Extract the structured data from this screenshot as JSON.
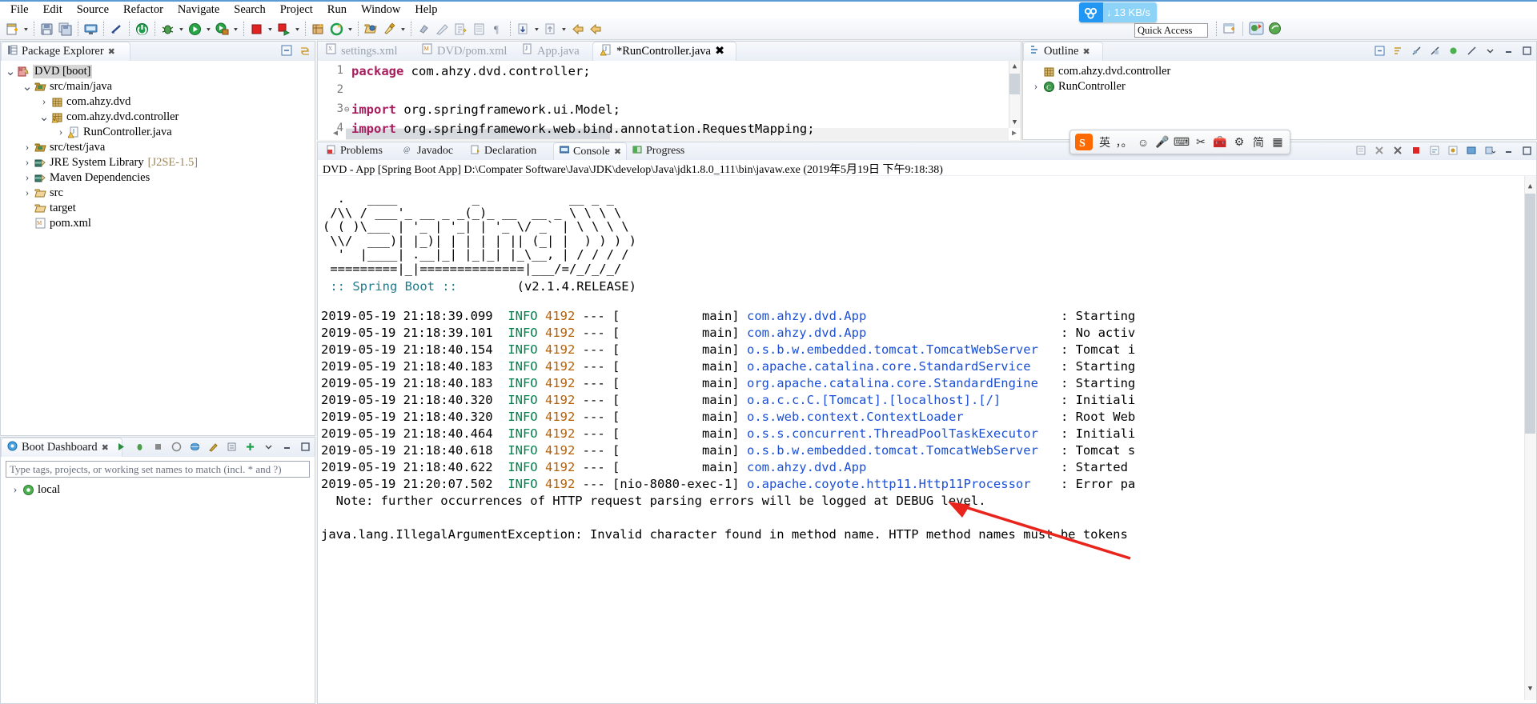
{
  "menubar": {
    "items": [
      {
        "label": "File",
        "mnemonic": "F"
      },
      {
        "label": "Edit",
        "mnemonic": "E"
      },
      {
        "label": "Source",
        "mnemonic": "S"
      },
      {
        "label": "Refactor",
        "mnemonic": "t"
      },
      {
        "label": "Navigate",
        "mnemonic": "N"
      },
      {
        "label": "Search",
        "mnemonic": "a"
      },
      {
        "label": "Project",
        "mnemonic": "P"
      },
      {
        "label": "Run",
        "mnemonic": "R"
      },
      {
        "label": "Window",
        "mnemonic": "W"
      },
      {
        "label": "Help",
        "mnemonic": "H"
      }
    ]
  },
  "toolbar": {
    "icons": [
      "new-wizard-icon",
      "save-icon",
      "save-all-icon",
      "print-screen-icon",
      "toggle-breakpoint-icon",
      "terminate-icon",
      "debug-icon",
      "run-icon",
      "run-external-tools-icon",
      "stop-icon",
      "coverage-icon",
      "new-package-icon",
      "refresh-icon",
      "open-type-icon",
      "search-icon",
      "pin-icon",
      "annotation-icon",
      "next-edit-icon",
      "previous-edit-icon",
      "paragraph-icon",
      "next-annotation-icon",
      "previous-annotation-icon",
      "back-icon",
      "forward-icon"
    ]
  },
  "download_widget": {
    "name": "download-speed-indicator",
    "speed": "13 KB/s",
    "arrow": "↓",
    "bg_color": "#2196f3",
    "value_bg": "#8dd3f7"
  },
  "quick_access": {
    "label": "Quick Access",
    "placeholder": "Quick Access"
  },
  "package_explorer": {
    "title": "Package Explorer",
    "tree": [
      {
        "label": "DVD [boot]",
        "indent": 0,
        "twist": "v",
        "icon": "maven-project-icon",
        "selected": true
      },
      {
        "label": "src/main/java",
        "indent": 1,
        "twist": "v",
        "icon": "source-folder-icon"
      },
      {
        "label": "com.ahzy.dvd",
        "indent": 2,
        "twist": ">",
        "icon": "package-icon"
      },
      {
        "label": "com.ahzy.dvd.controller",
        "indent": 2,
        "twist": "v",
        "icon": "package-warning-icon"
      },
      {
        "label": "RunController.java",
        "indent": 3,
        "twist": ">",
        "icon": "java-file-warning-icon"
      },
      {
        "label": "src/test/java",
        "indent": 1,
        "twist": ">",
        "icon": "source-folder-icon"
      },
      {
        "label": "JRE System Library",
        "suffix": "[J2SE-1.5]",
        "indent": 1,
        "twist": ">",
        "icon": "library-icon"
      },
      {
        "label": "Maven Dependencies",
        "indent": 1,
        "twist": ">",
        "icon": "library-icon"
      },
      {
        "label": "src",
        "indent": 1,
        "twist": ">",
        "icon": "folder-icon"
      },
      {
        "label": "target",
        "indent": 1,
        "twist": "",
        "icon": "folder-icon"
      },
      {
        "label": "pom.xml",
        "indent": 1,
        "twist": "",
        "icon": "maven-pom-icon"
      }
    ]
  },
  "boot_dashboard": {
    "title": "Boot Dashboard",
    "filter_placeholder": "Type tags, projects, or working set names to match (incl. * and ?)",
    "items": [
      {
        "label": "local",
        "twist": ">",
        "icon": "boot-local-icon"
      }
    ]
  },
  "editor": {
    "tabs": [
      {
        "label": "settings.xml",
        "icon": "xml-file-icon",
        "active": false
      },
      {
        "label": "DVD/pom.xml",
        "icon": "maven-file-icon",
        "active": false
      },
      {
        "label": "App.java",
        "icon": "java-file-icon",
        "active": false
      },
      {
        "label": "*RunController.java",
        "icon": "java-file-warning-icon",
        "active": true
      }
    ],
    "lines": [
      {
        "num": "1",
        "fold": "",
        "code": "package com.ahzy.dvd.controller;",
        "keyword": "package"
      },
      {
        "num": "2",
        "fold": "",
        "code": "",
        "keyword": ""
      },
      {
        "num": "3",
        "fold": "⊖",
        "code": "import org.springframework.ui.Model;",
        "keyword": "import"
      },
      {
        "num": "4",
        "fold": "",
        "code": "import org.springframework.web.bind.annotation.RequestMapping;",
        "keyword": "import"
      }
    ]
  },
  "outline": {
    "title": "Outline",
    "items": [
      {
        "label": "com.ahzy.dvd.controller",
        "twist": "",
        "icon": "package-icon",
        "indent": 0
      },
      {
        "label": "RunController",
        "twist": ">",
        "icon": "class-icon",
        "indent": 0
      }
    ]
  },
  "bottom_panel": {
    "tabs": [
      {
        "label": "Problems",
        "icon": "problems-icon",
        "active": false
      },
      {
        "label": "Javadoc",
        "icon": "javadoc-icon",
        "active": false
      },
      {
        "label": "Declaration",
        "icon": "declaration-icon",
        "active": false
      },
      {
        "label": "Console",
        "icon": "console-icon",
        "active": true
      },
      {
        "label": "Progress",
        "icon": "progress-icon",
        "active": false
      }
    ],
    "launch_line": "DVD - App [Spring Boot App] D:\\Compater Software\\Java\\JDK\\develop\\Java\\jdk1.8.0_111\\bin\\javaw.exe (2019年5月19日 下午9:18:38)"
  },
  "console": {
    "banner": [
      "  .   ____          _            __ _ _",
      " /\\\\ / ___'_ __ _ _(_)_ __  __ _ \\ \\ \\ \\",
      "( ( )\\___ | '_ | '_| | '_ \\/ _` | \\ \\ \\ \\",
      " \\\\/  ___)| |_)| | | | | || (_| |  ) ) ) )",
      "  '  |____| .__|_| |_|_| |_\\__, | / / / /",
      " =========|_|==============|___/=/_/_/_/"
    ],
    "banner_title": " :: Spring Boot :: ",
    "banner_version": "       (v2.1.4.RELEASE)",
    "log_lines": [
      {
        "time": "2019-05-19 21:18:39.099",
        "level": "INFO",
        "pid": "4192",
        "sep": "--- [",
        "thread": "           main]",
        "cls": "com.ahzy.dvd.App",
        "msg": ": Starting"
      },
      {
        "time": "2019-05-19 21:18:39.101",
        "level": "INFO",
        "pid": "4192",
        "sep": "--- [",
        "thread": "           main]",
        "cls": "com.ahzy.dvd.App",
        "msg": ": No activ"
      },
      {
        "time": "2019-05-19 21:18:40.154",
        "level": "INFO",
        "pid": "4192",
        "sep": "--- [",
        "thread": "           main]",
        "cls": "o.s.b.w.embedded.tomcat.TomcatWebServer",
        "msg": ": Tomcat i"
      },
      {
        "time": "2019-05-19 21:18:40.183",
        "level": "INFO",
        "pid": "4192",
        "sep": "--- [",
        "thread": "           main]",
        "cls": "o.apache.catalina.core.StandardService",
        "msg": ": Starting"
      },
      {
        "time": "2019-05-19 21:18:40.183",
        "level": "INFO",
        "pid": "4192",
        "sep": "--- [",
        "thread": "           main]",
        "cls": "org.apache.catalina.core.StandardEngine",
        "msg": ": Starting"
      },
      {
        "time": "2019-05-19 21:18:40.320",
        "level": "INFO",
        "pid": "4192",
        "sep": "--- [",
        "thread": "           main]",
        "cls": "o.a.c.c.C.[Tomcat].[localhost].[/]",
        "msg": ": Initiali"
      },
      {
        "time": "2019-05-19 21:18:40.320",
        "level": "INFO",
        "pid": "4192",
        "sep": "--- [",
        "thread": "           main]",
        "cls": "o.s.web.context.ContextLoader",
        "msg": ": Root Web"
      },
      {
        "time": "2019-05-19 21:18:40.464",
        "level": "INFO",
        "pid": "4192",
        "sep": "--- [",
        "thread": "           main]",
        "cls": "o.s.s.concurrent.ThreadPoolTaskExecutor",
        "msg": ": Initiali"
      },
      {
        "time": "2019-05-19 21:18:40.618",
        "level": "INFO",
        "pid": "4192",
        "sep": "--- [",
        "thread": "           main]",
        "cls": "o.s.b.w.embedded.tomcat.TomcatWebServer",
        "msg": ": Tomcat s"
      },
      {
        "time": "2019-05-19 21:18:40.622",
        "level": "INFO",
        "pid": "4192",
        "sep": "--- [",
        "thread": "           main]",
        "cls": "com.ahzy.dvd.App",
        "msg": ": Started"
      },
      {
        "time": "2019-05-19 21:20:07.502",
        "level": "INFO",
        "pid": "4192",
        "sep": "--- [",
        "thread": "nio-8080-exec-1]",
        "cls": "o.apache.coyote.http11.Http11Processor",
        "msg": ": Error pa"
      }
    ],
    "note_line": "  Note: further occurrences of HTTP request parsing errors will be logged at DEBUG level.",
    "exception_line": "java.lang.IllegalArgumentException: Invalid character found in method name. HTTP method names must be tokens"
  },
  "ime_toolbar": {
    "name": "sogou-ime-toolbar",
    "items": [
      {
        "name": "sogou-logo-icon",
        "glyph": "S"
      },
      {
        "name": "chinese-mode-icon",
        "glyph": "英"
      },
      {
        "name": "punctuation-icon",
        "glyph": "，。"
      },
      {
        "name": "emoji-icon",
        "glyph": "☺"
      },
      {
        "name": "voice-input-icon",
        "glyph": "🎤"
      },
      {
        "name": "soft-keyboard-icon",
        "glyph": "⌨"
      },
      {
        "name": "screenshot-icon",
        "glyph": "✂"
      },
      {
        "name": "toolbox-icon",
        "glyph": "🧰"
      },
      {
        "name": "settings-icon",
        "glyph": "⚙"
      },
      {
        "name": "simplified-chinese-icon",
        "glyph": "简"
      },
      {
        "name": "skin-icon",
        "glyph": "▦"
      }
    ]
  },
  "annotation": {
    "name": "red-arrow-annotation",
    "color": "#e8241c"
  }
}
